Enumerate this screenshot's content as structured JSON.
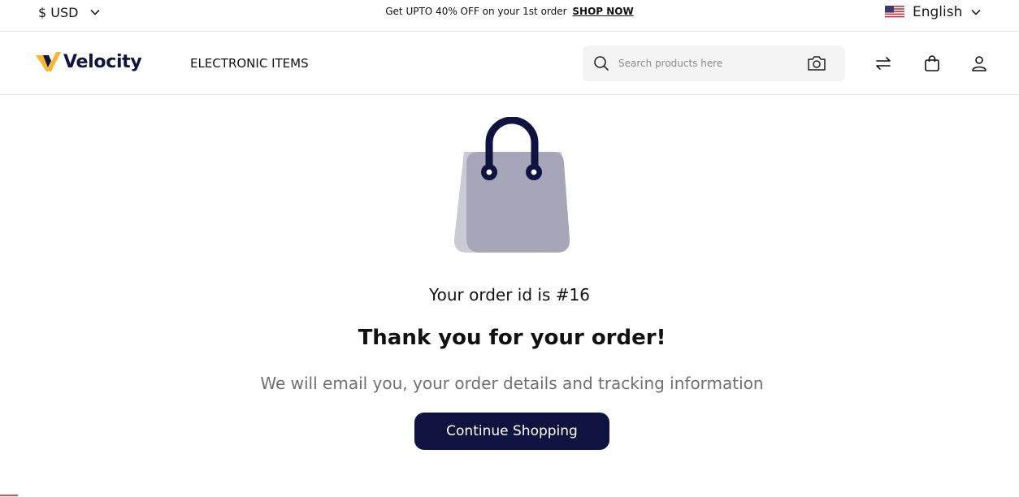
{
  "topbar": {
    "currency": "$ USD",
    "promo_text": "Get UPTO 40% OFF on your 1st order",
    "promo_link": "SHOP NOW",
    "language": "English"
  },
  "header": {
    "logo_text": "Velocity",
    "nav_link": "ELECTRONIC ITEMS",
    "search_placeholder": "Search products here"
  },
  "main": {
    "order_id_text": "Your order id is #16",
    "thanks_text": "Thank you for your order!",
    "message": "We will email you, your order details and tracking information",
    "continue_button": "Continue Shopping"
  },
  "colors": {
    "brand_navy": "#0f1340",
    "logo_yellow": "#f5b731",
    "bag_gray": "#a6a6b8"
  },
  "icons": [
    "chevron-down-icon",
    "us-flag-icon",
    "logo-v-icon",
    "search-icon",
    "camera-icon",
    "compare-arrows-icon",
    "cart-bag-icon",
    "user-icon",
    "shopping-bag-illustration"
  ]
}
